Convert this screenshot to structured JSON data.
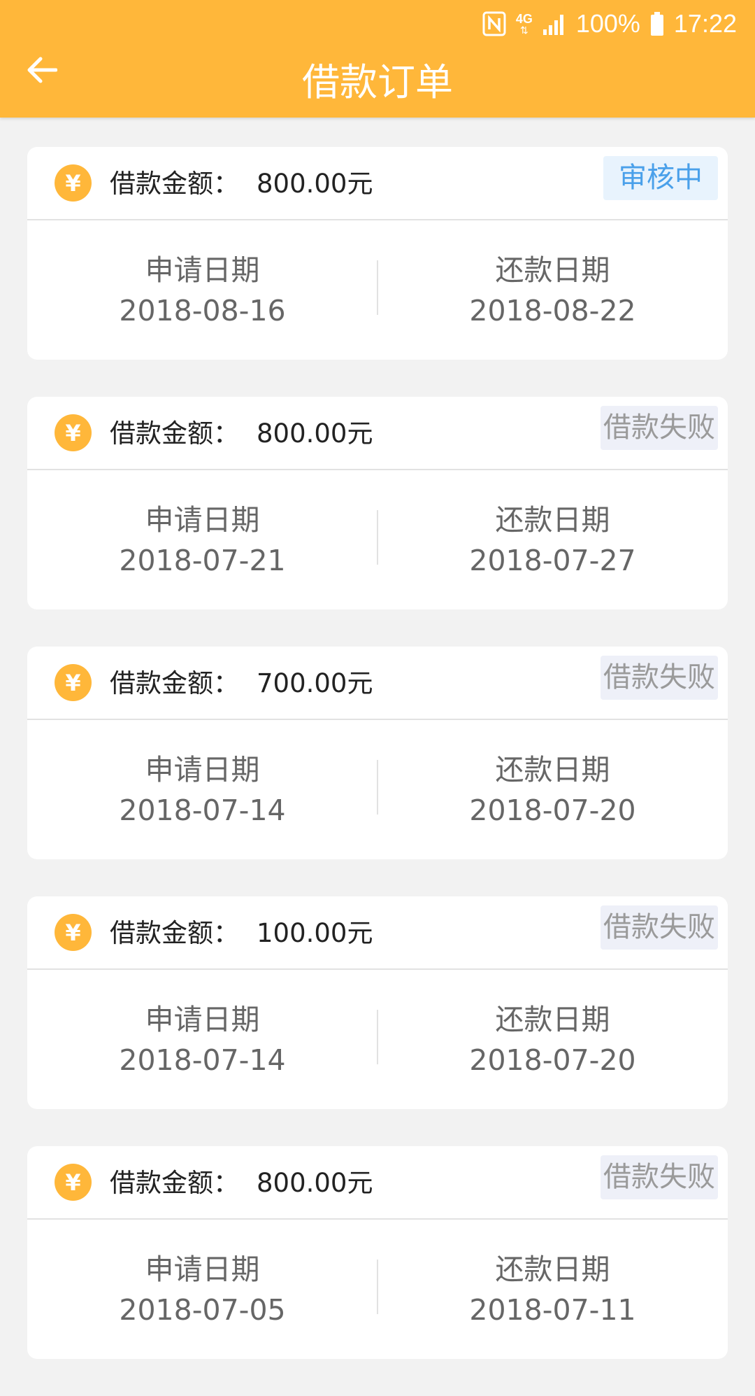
{
  "status_bar": {
    "signal_label": "4G",
    "battery": "100%",
    "time": "17:22",
    "icons": [
      "nfc-icon",
      "network-4g-icon",
      "signal-icon",
      "battery-icon"
    ]
  },
  "header": {
    "title": "借款订单",
    "back_icon": "arrow-left-icon"
  },
  "colors": {
    "brand": "#ffb73a",
    "status_review": "#4aa0ea",
    "status_failed": "#9a9a9a"
  },
  "orders": [
    {
      "currency_symbol": "¥",
      "amount_label": "借款金额：",
      "amount": "800.00元",
      "status": "审核中",
      "status_type": "review",
      "apply_label": "申请日期",
      "apply_date": "2018-08-16",
      "repay_label": "还款日期",
      "repay_date": "2018-08-22"
    },
    {
      "currency_symbol": "¥",
      "amount_label": "借款金额：",
      "amount": "800.00元",
      "status": "借款失败",
      "status_type": "failed",
      "apply_label": "申请日期",
      "apply_date": "2018-07-21",
      "repay_label": "还款日期",
      "repay_date": "2018-07-27"
    },
    {
      "currency_symbol": "¥",
      "amount_label": "借款金额：",
      "amount": "700.00元",
      "status": "借款失败",
      "status_type": "failed",
      "apply_label": "申请日期",
      "apply_date": "2018-07-14",
      "repay_label": "还款日期",
      "repay_date": "2018-07-20"
    },
    {
      "currency_symbol": "¥",
      "amount_label": "借款金额：",
      "amount": "100.00元",
      "status": "借款失败",
      "status_type": "failed",
      "apply_label": "申请日期",
      "apply_date": "2018-07-14",
      "repay_label": "还款日期",
      "repay_date": "2018-07-20"
    },
    {
      "currency_symbol": "¥",
      "amount_label": "借款金额：",
      "amount": "800.00元",
      "status": "借款失败",
      "status_type": "failed",
      "apply_label": "申请日期",
      "apply_date": "2018-07-05",
      "repay_label": "还款日期",
      "repay_date": "2018-07-11"
    }
  ]
}
